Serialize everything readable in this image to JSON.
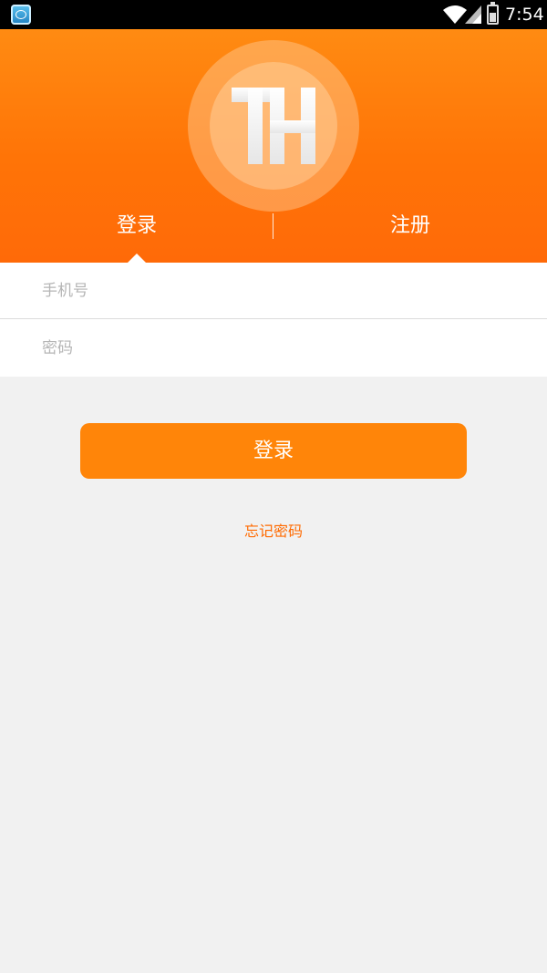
{
  "status_bar": {
    "time": "7:54",
    "app_icon": "app-notification-icon",
    "wifi_icon": "wifi-icon",
    "signal_icon": "cell-signal-icon",
    "battery_icon": "battery-charging-icon"
  },
  "header": {
    "logo_text": "TH",
    "background_color": "#ff7a0a"
  },
  "tabs": [
    {
      "label": "登录",
      "selected": true
    },
    {
      "label": "注册",
      "selected": false
    }
  ],
  "form": {
    "phone": {
      "placeholder": "手机号",
      "value": ""
    },
    "password": {
      "placeholder": "密码",
      "value": ""
    }
  },
  "login_button": {
    "label": "登录",
    "color": "#ff8509"
  },
  "forgot_password": {
    "label": "忘记密码",
    "color": "#ff6a00"
  }
}
